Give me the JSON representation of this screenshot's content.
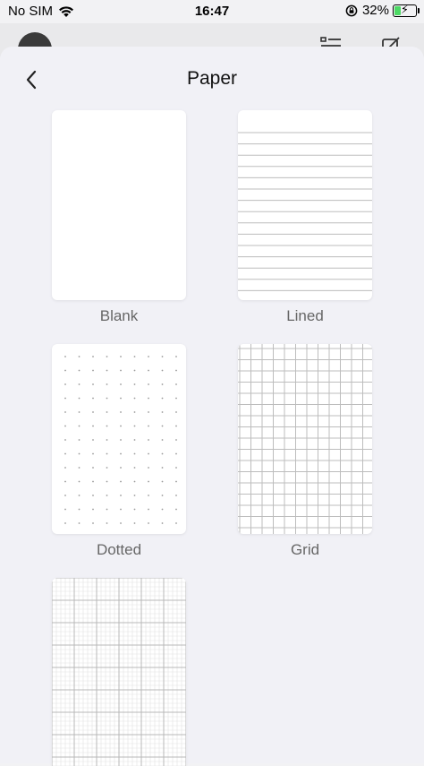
{
  "status_bar": {
    "carrier": "No SIM",
    "time": "16:47",
    "battery_percent": "32%",
    "battery_level": 0.32,
    "battery_fill_color": "#4cd964",
    "icons": [
      "wifi-icon",
      "orientation-lock-icon",
      "battery-icon"
    ]
  },
  "sheet": {
    "title": "Paper",
    "back_icon": "chevron-left-icon"
  },
  "papers": [
    {
      "label": "Blank",
      "style": "blank"
    },
    {
      "label": "Lined",
      "style": "lined"
    },
    {
      "label": "Dotted",
      "style": "dotted"
    },
    {
      "label": "Grid",
      "style": "grid"
    },
    {
      "label": "",
      "style": "graph"
    }
  ],
  "colors": {
    "sheet_background": "#f1f1f6",
    "tile_background": "#ffffff",
    "label_text": "#666666"
  }
}
